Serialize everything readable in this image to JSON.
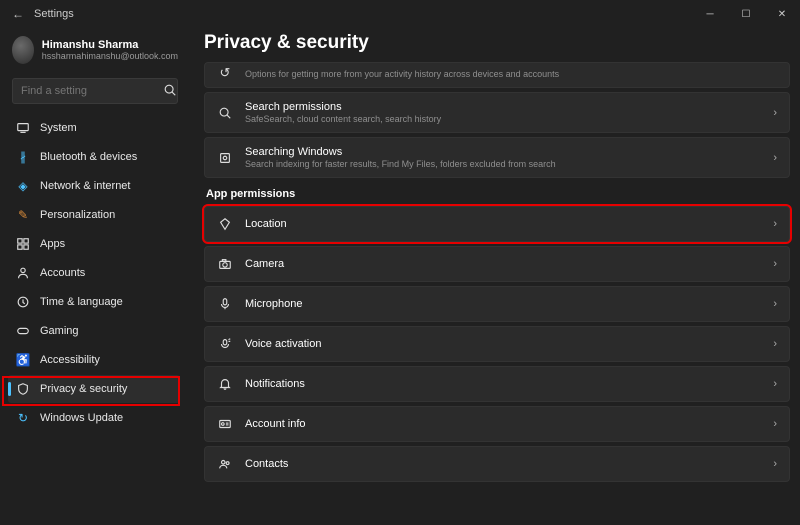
{
  "titlebar": {
    "title": "Settings"
  },
  "profile": {
    "name": "Himanshu Sharma",
    "email": "hssharmahimanshu@outlook.com"
  },
  "search": {
    "placeholder": "Find a setting"
  },
  "nav": {
    "items": [
      {
        "label": "System"
      },
      {
        "label": "Bluetooth & devices"
      },
      {
        "label": "Network & internet"
      },
      {
        "label": "Personalization"
      },
      {
        "label": "Apps"
      },
      {
        "label": "Accounts"
      },
      {
        "label": "Time & language"
      },
      {
        "label": "Gaming"
      },
      {
        "label": "Accessibility"
      },
      {
        "label": "Privacy & security"
      },
      {
        "label": "Windows Update"
      }
    ]
  },
  "page": {
    "title": "Privacy & security",
    "section_app": "App permissions",
    "truncated_sub": "Options for getting more from your activity history across devices and accounts",
    "cards": {
      "search_perm": {
        "title": "Search permissions",
        "sub": "SafeSearch, cloud content search, search history"
      },
      "search_win": {
        "title": "Searching Windows",
        "sub": "Search indexing for faster results, Find My Files, folders excluded from search"
      },
      "location": {
        "title": "Location"
      },
      "camera": {
        "title": "Camera"
      },
      "microphone": {
        "title": "Microphone"
      },
      "voice": {
        "title": "Voice activation"
      },
      "notifications": {
        "title": "Notifications"
      },
      "account": {
        "title": "Account info"
      },
      "contacts": {
        "title": "Contacts"
      }
    }
  }
}
